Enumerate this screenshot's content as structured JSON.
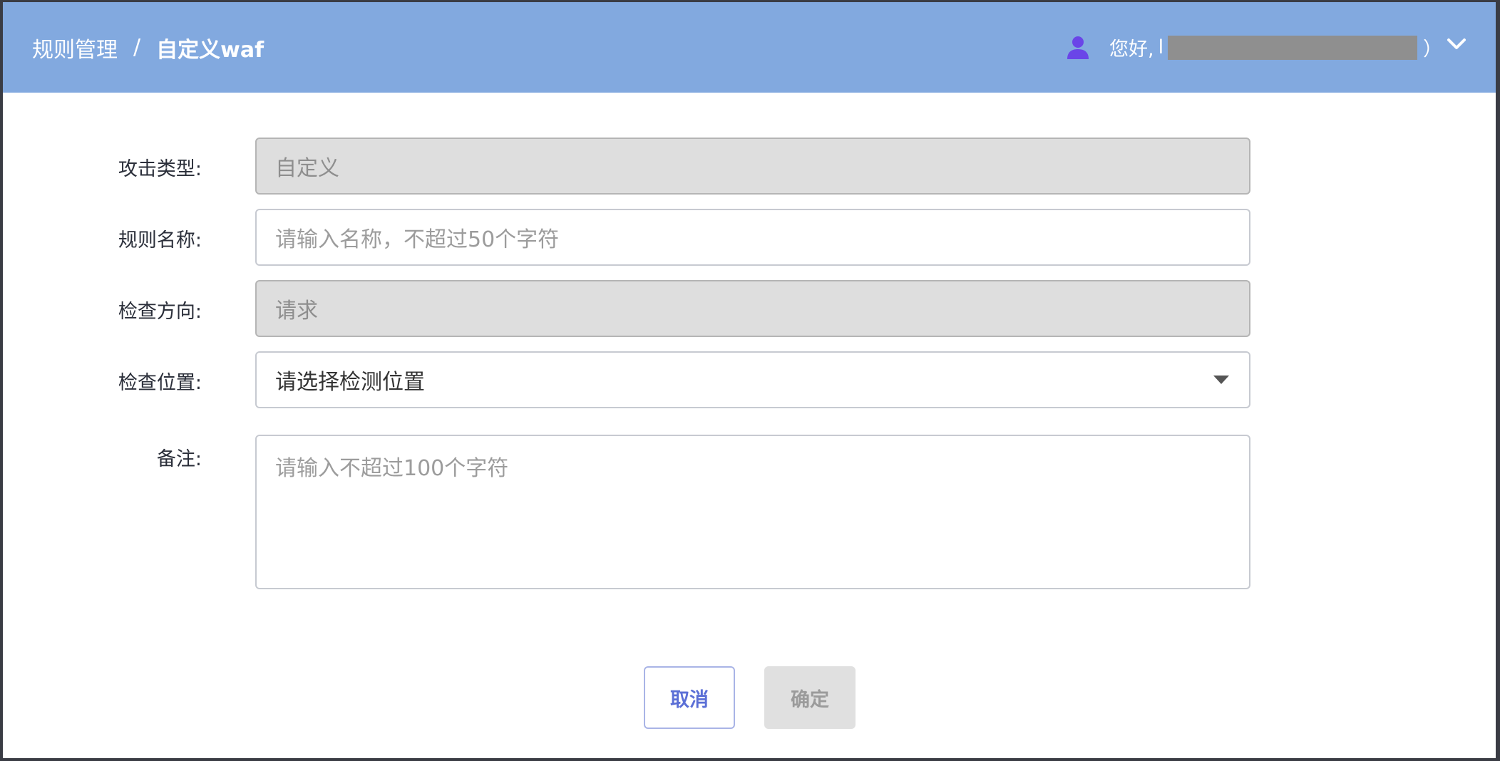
{
  "header": {
    "breadcrumb_parent": "规则管理",
    "breadcrumb_separator": "/",
    "breadcrumb_current": "自定义waf",
    "greeting": "您好,",
    "greeting_prefix_char": "l",
    "greeting_suffix": "）",
    "user_icon": "user-icon",
    "menu_icon": "chevron-down-icon"
  },
  "form": {
    "attack_type": {
      "label": "攻击类型:",
      "value": "自定义"
    },
    "rule_name": {
      "label": "规则名称:",
      "placeholder": "请输入名称，不超过50个字符"
    },
    "direction": {
      "label": "检查方向:",
      "value": "请求"
    },
    "position": {
      "label": "检查位置:",
      "value": "请选择检测位置"
    },
    "remark": {
      "label": "备注:",
      "placeholder": "请输入不超过100个字符"
    }
  },
  "actions": {
    "cancel_label": "取消",
    "confirm_label": "确定"
  },
  "colors": {
    "header_bg": "#82a9df",
    "user_icon": "#6a45e8",
    "cancel_text": "#5b6fd6"
  }
}
